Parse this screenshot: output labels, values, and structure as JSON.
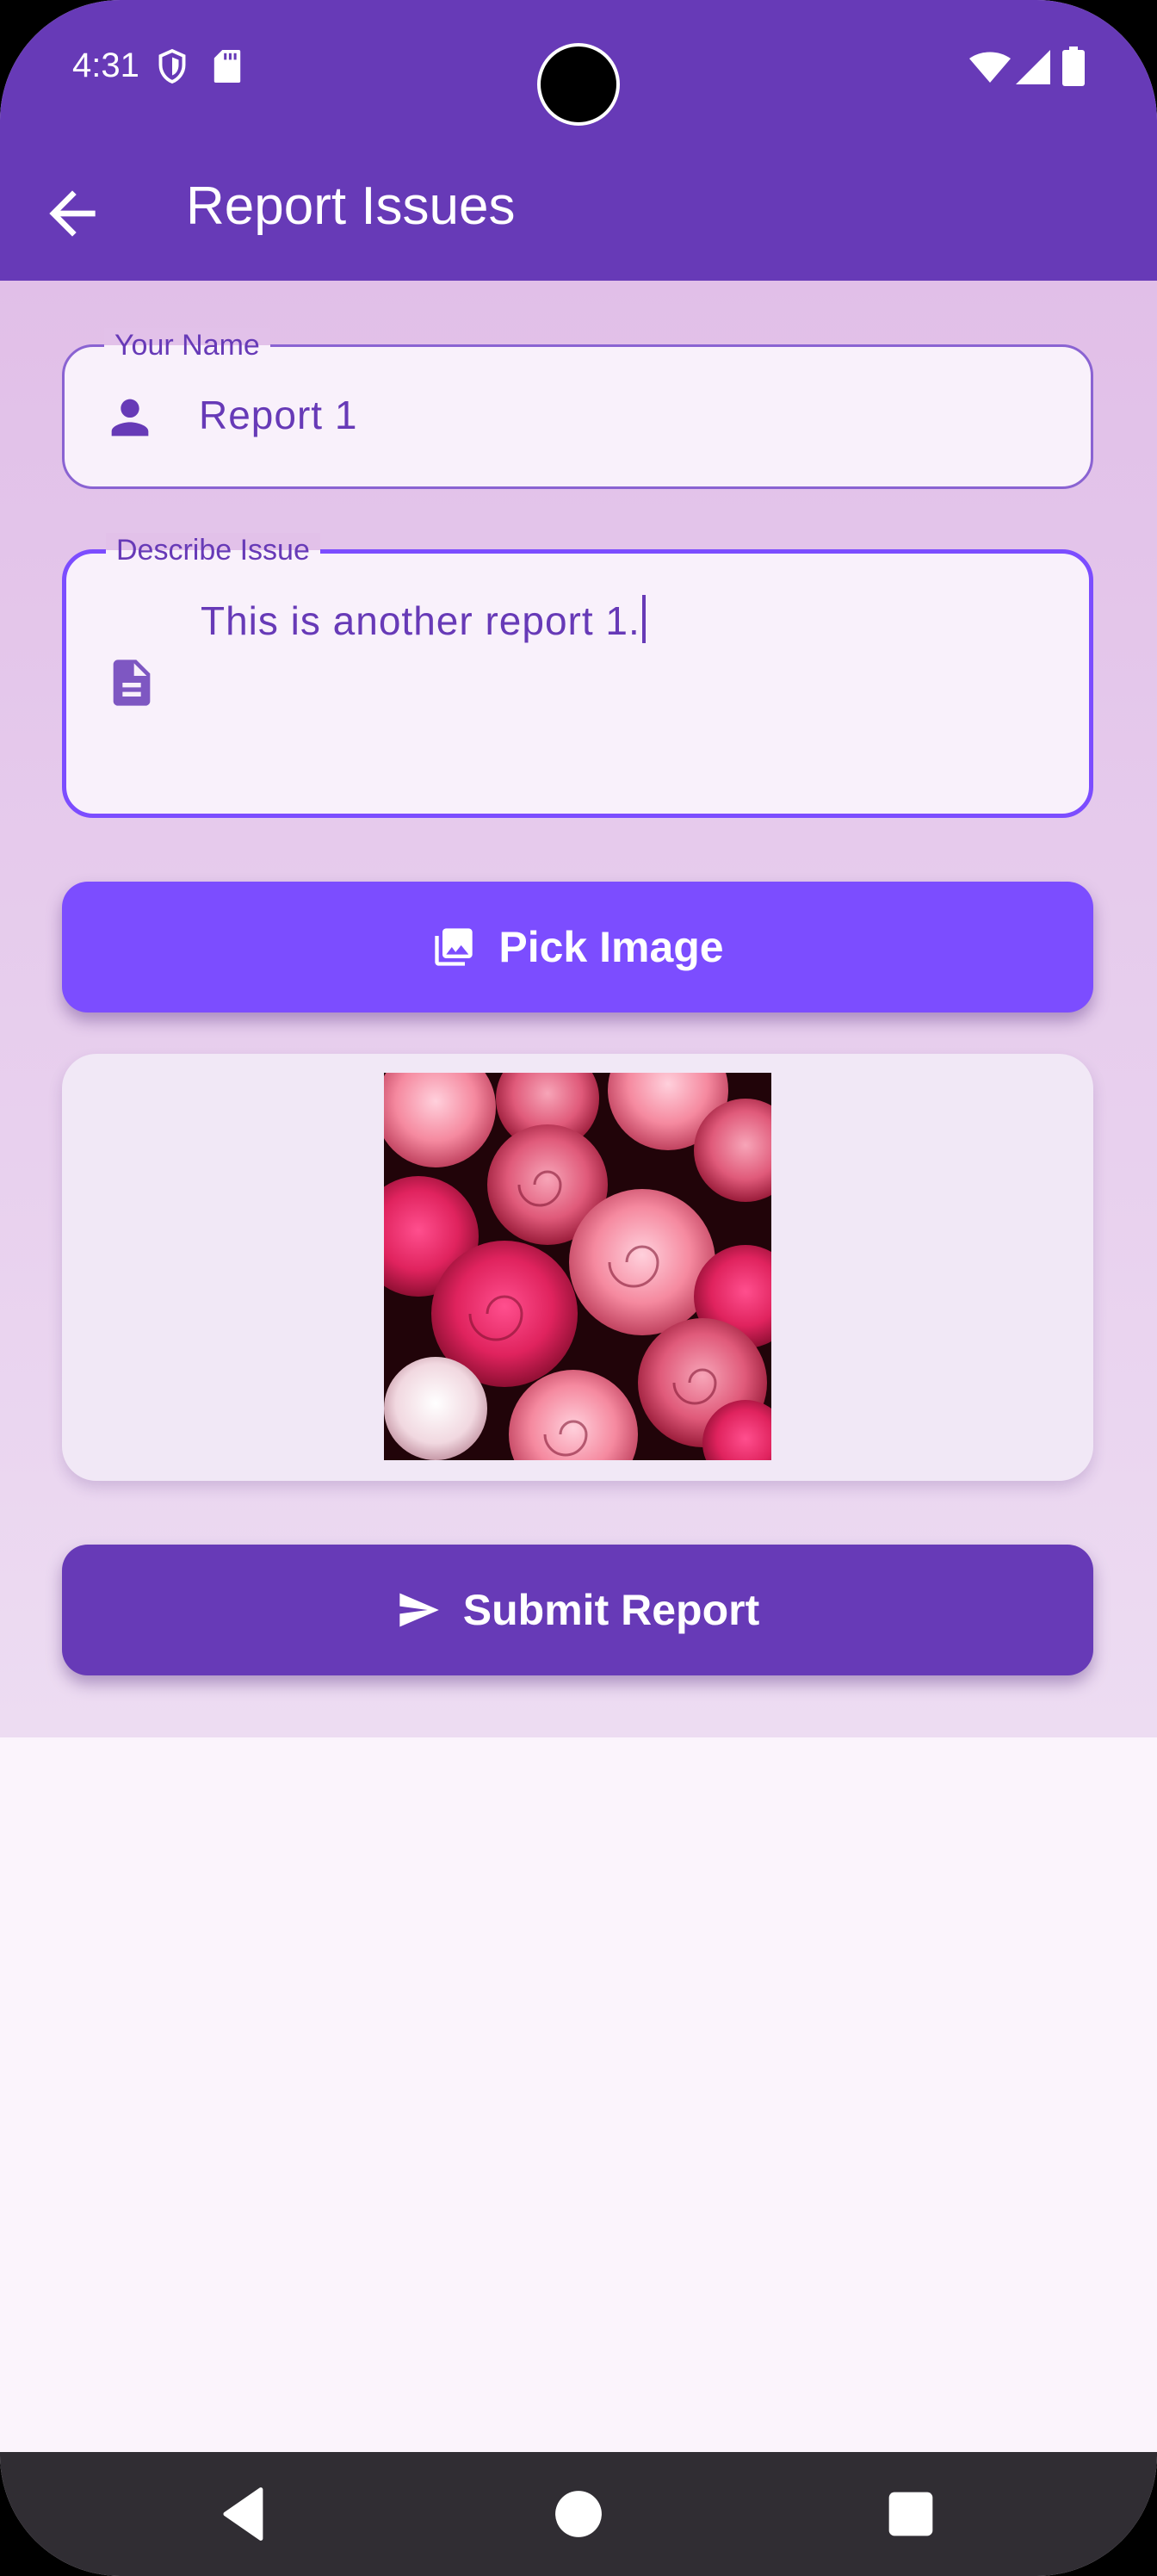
{
  "status_bar": {
    "time": "4:31"
  },
  "app_bar": {
    "title": "Report Issues",
    "back_icon": "arrow-back-icon"
  },
  "form": {
    "name_field": {
      "label": "Your Name",
      "value": "Report 1",
      "icon": "person-icon"
    },
    "issue_field": {
      "label": "Describe Issue",
      "value": "This is another report 1.",
      "icon": "document-icon"
    },
    "pick_image_button": {
      "label": "Pick Image",
      "icon": "image-icon"
    },
    "preview": {
      "alt": "Selected image preview (pink roses)"
    },
    "submit_button": {
      "label": "Submit Report",
      "icon": "send-icon"
    }
  },
  "colors": {
    "primary": "#673ab7",
    "accent": "#7c4dff",
    "background": "#fbf4fc"
  }
}
